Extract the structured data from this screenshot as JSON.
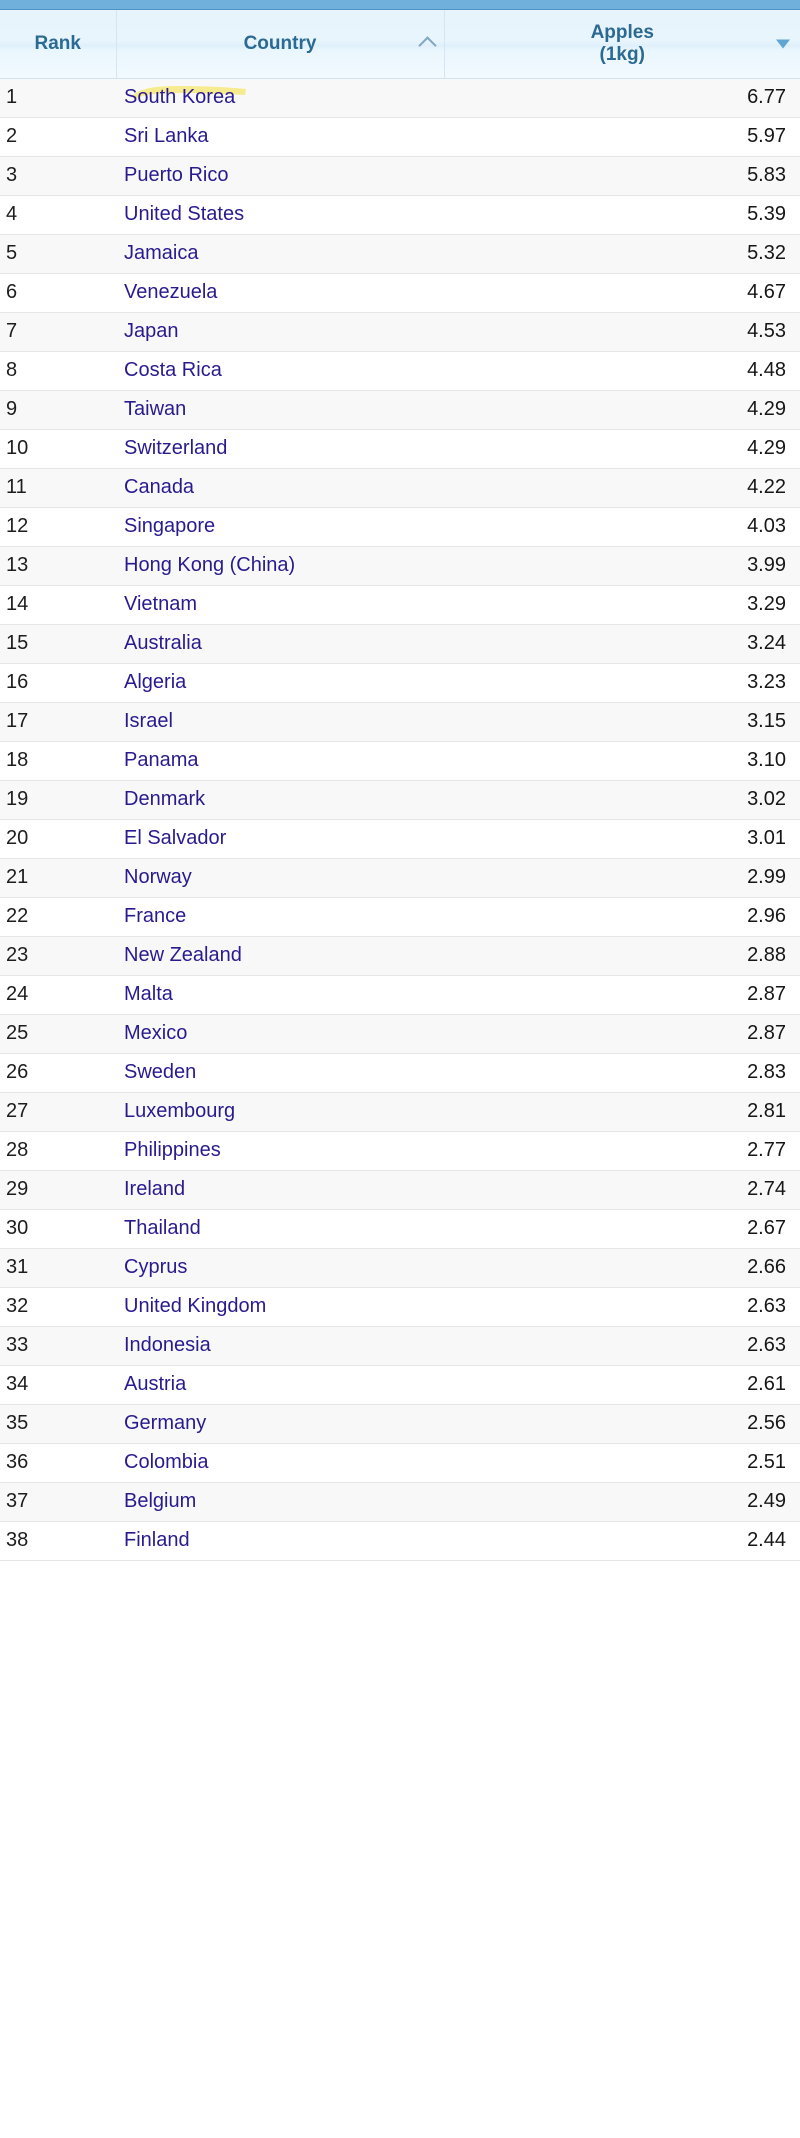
{
  "table": {
    "columns": [
      {
        "key": "rank",
        "label": "Rank",
        "sort": "none"
      },
      {
        "key": "country",
        "label": "Country",
        "sort": "asc",
        "sort_icon": "chevron-up-icon"
      },
      {
        "key": "value",
        "label": "Apples\n(1kg)",
        "label_line1": "Apples",
        "label_line2": "(1kg)",
        "sort": "desc",
        "sort_icon": "triangle-down-icon"
      }
    ],
    "rows": [
      {
        "rank": "1",
        "country": "South Korea",
        "value": "6.77",
        "highlighted": true
      },
      {
        "rank": "2",
        "country": "Sri Lanka",
        "value": "5.97"
      },
      {
        "rank": "3",
        "country": "Puerto Rico",
        "value": "5.83"
      },
      {
        "rank": "4",
        "country": "United States",
        "value": "5.39"
      },
      {
        "rank": "5",
        "country": "Jamaica",
        "value": "5.32"
      },
      {
        "rank": "6",
        "country": "Venezuela",
        "value": "4.67"
      },
      {
        "rank": "7",
        "country": "Japan",
        "value": "4.53"
      },
      {
        "rank": "8",
        "country": "Costa Rica",
        "value": "4.48"
      },
      {
        "rank": "9",
        "country": "Taiwan",
        "value": "4.29"
      },
      {
        "rank": "10",
        "country": "Switzerland",
        "value": "4.29"
      },
      {
        "rank": "11",
        "country": "Canada",
        "value": "4.22"
      },
      {
        "rank": "12",
        "country": "Singapore",
        "value": "4.03"
      },
      {
        "rank": "13",
        "country": "Hong Kong (China)",
        "value": "3.99"
      },
      {
        "rank": "14",
        "country": "Vietnam",
        "value": "3.29"
      },
      {
        "rank": "15",
        "country": "Australia",
        "value": "3.24"
      },
      {
        "rank": "16",
        "country": "Algeria",
        "value": "3.23"
      },
      {
        "rank": "17",
        "country": "Israel",
        "value": "3.15"
      },
      {
        "rank": "18",
        "country": "Panama",
        "value": "3.10"
      },
      {
        "rank": "19",
        "country": "Denmark",
        "value": "3.02"
      },
      {
        "rank": "20",
        "country": "El Salvador",
        "value": "3.01"
      },
      {
        "rank": "21",
        "country": "Norway",
        "value": "2.99"
      },
      {
        "rank": "22",
        "country": "France",
        "value": "2.96"
      },
      {
        "rank": "23",
        "country": "New Zealand",
        "value": "2.88"
      },
      {
        "rank": "24",
        "country": "Malta",
        "value": "2.87"
      },
      {
        "rank": "25",
        "country": "Mexico",
        "value": "2.87"
      },
      {
        "rank": "26",
        "country": "Sweden",
        "value": "2.83"
      },
      {
        "rank": "27",
        "country": "Luxembourg",
        "value": "2.81"
      },
      {
        "rank": "28",
        "country": "Philippines",
        "value": "2.77"
      },
      {
        "rank": "29",
        "country": "Ireland",
        "value": "2.74"
      },
      {
        "rank": "30",
        "country": "Thailand",
        "value": "2.67"
      },
      {
        "rank": "31",
        "country": "Cyprus",
        "value": "2.66"
      },
      {
        "rank": "32",
        "country": "United Kingdom",
        "value": "2.63"
      },
      {
        "rank": "33",
        "country": "Indonesia",
        "value": "2.63"
      },
      {
        "rank": "34",
        "country": "Austria",
        "value": "2.61"
      },
      {
        "rank": "35",
        "country": "Germany",
        "value": "2.56"
      },
      {
        "rank": "36",
        "country": "Colombia",
        "value": "2.51"
      },
      {
        "rank": "37",
        "country": "Belgium",
        "value": "2.49"
      },
      {
        "rank": "38",
        "country": "Finland",
        "value": "2.44"
      }
    ]
  },
  "annotation": {
    "type": "highlighter-stroke",
    "target_row": "1",
    "target_text": "South Korea",
    "color": "#f7eb8f"
  },
  "colors": {
    "top_bar": "#6fb0dc",
    "header_text": "#2b6a93",
    "link": "#2a1a8f",
    "row_odd": "#f8f8f8",
    "row_even": "#ffffff",
    "highlight": "#f7eb8f"
  }
}
